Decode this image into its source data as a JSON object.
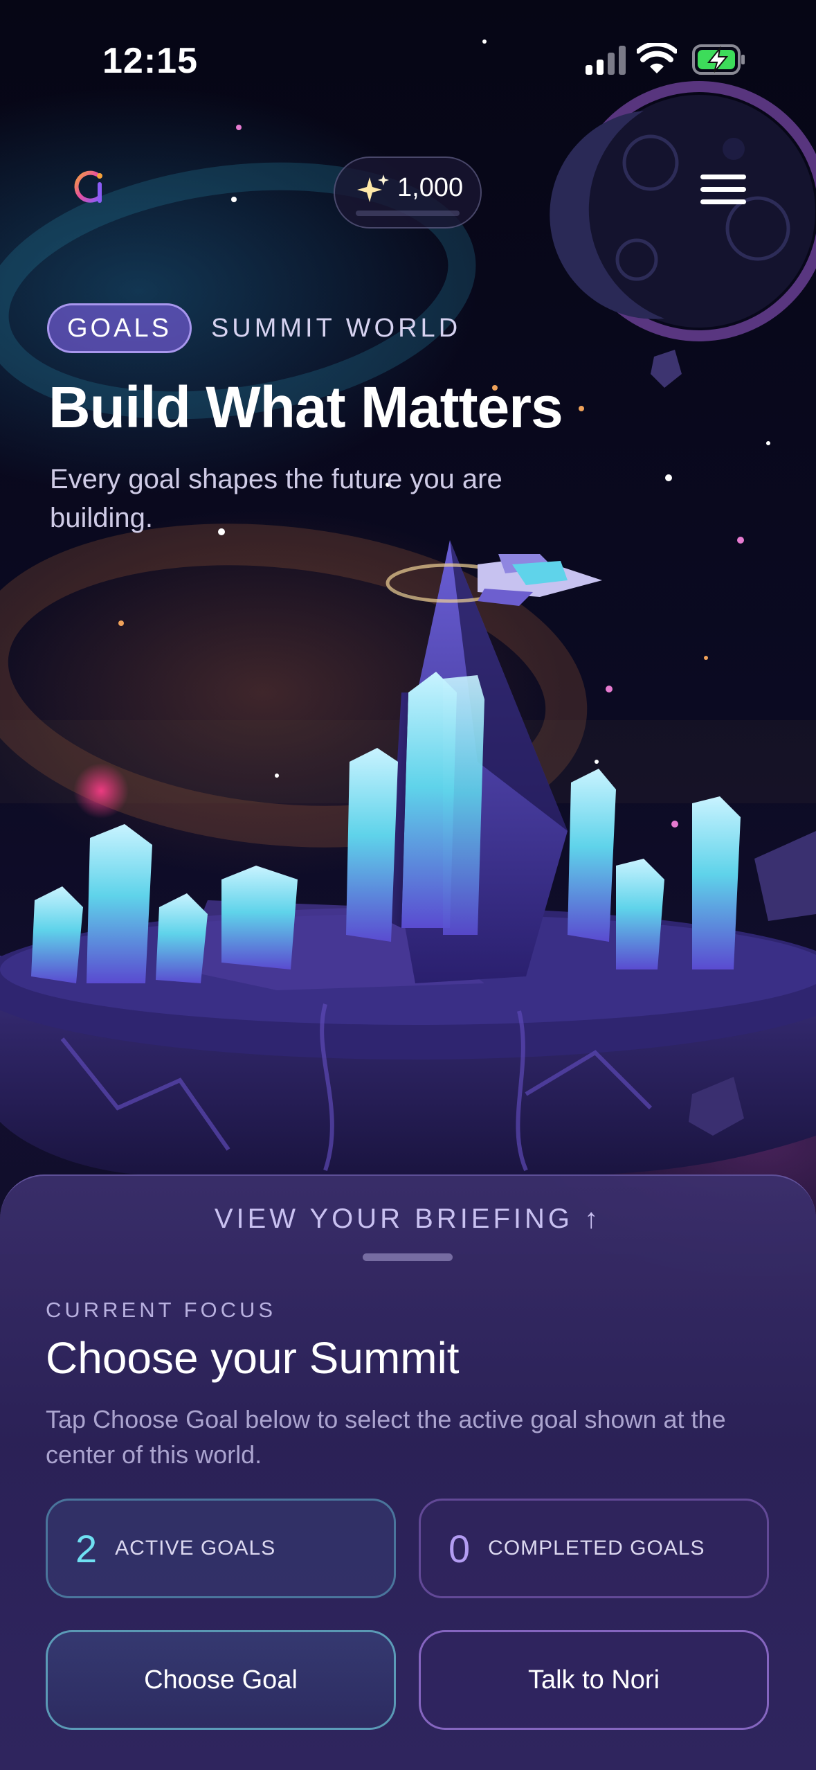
{
  "status_bar": {
    "time": "12:15"
  },
  "header": {
    "points": "1,000",
    "logo_icon": "app-logo-icon",
    "sparkle_icon": "sparkle-icon",
    "menu_icon": "hamburger-menu-icon"
  },
  "hero": {
    "tag": "GOALS",
    "world": "SUMMIT WORLD",
    "title": "Build What Matters",
    "subtitle": "Every goal shapes the future you are building."
  },
  "sheet": {
    "briefing_label": "VIEW YOUR BRIEFING ↑",
    "focus_label": "CURRENT FOCUS",
    "focus_title": "Choose your Summit",
    "focus_description": "Tap Choose Goal below to select the active goal shown at the center of this world.",
    "stats": {
      "active": {
        "value": "2",
        "label": "ACTIVE GOALS"
      },
      "completed": {
        "value": "0",
        "label": "COMPLETED GOALS"
      }
    },
    "buttons": {
      "choose": "Choose Goal",
      "talk": "Talk to Nori"
    }
  },
  "colors": {
    "background": "#07061a",
    "accent_cyan": "#6fe0f2",
    "accent_purple": "#b39cf2",
    "tag_purple": "#785cdc",
    "battery_green": "#3ddc5a"
  }
}
